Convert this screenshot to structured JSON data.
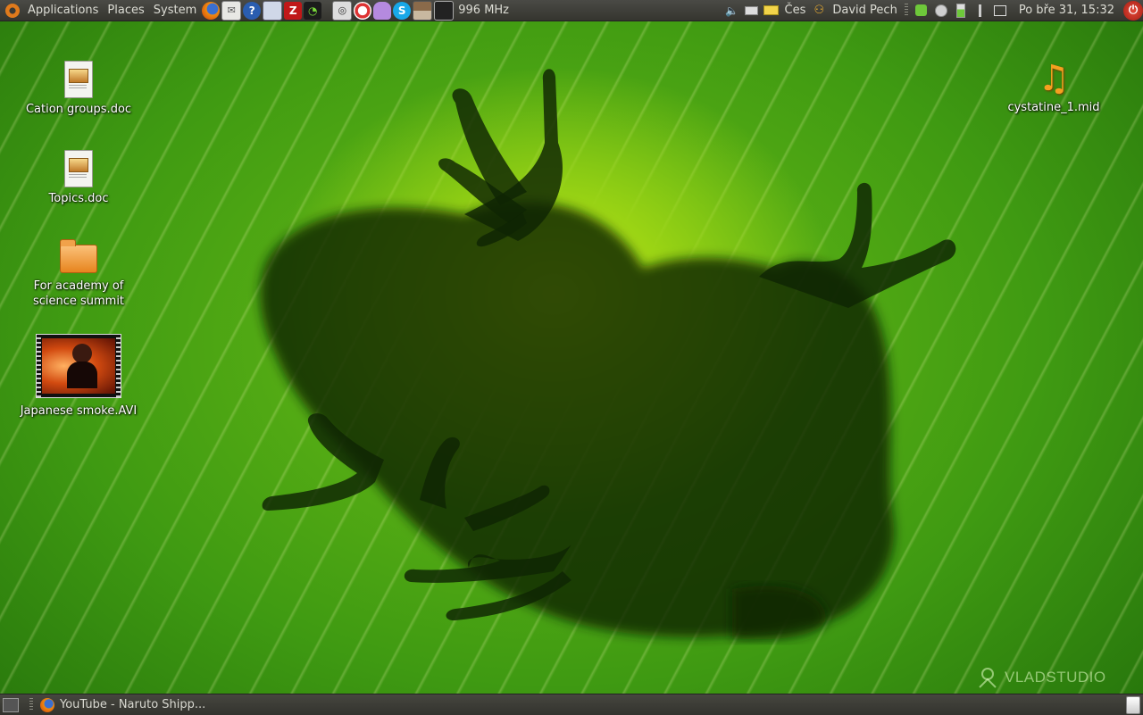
{
  "top_panel": {
    "menus": [
      "Applications",
      "Places",
      "System"
    ],
    "launchers": [
      {
        "icon": "firefox-icon"
      },
      {
        "icon": "mail-icon"
      },
      {
        "icon": "help-icon"
      },
      {
        "icon": "network-icon"
      },
      {
        "icon": "filezilla-icon",
        "glyph": "Z"
      },
      {
        "icon": "swirl-icon"
      },
      {
        "icon": "media-player-icon"
      },
      {
        "icon": "lifebuoy-icon"
      },
      {
        "icon": "pidgin-icon"
      },
      {
        "icon": "skype-icon",
        "glyph": "S"
      },
      {
        "icon": "brown-square-icon"
      },
      {
        "icon": "cpu-monitor-icon"
      }
    ],
    "cpu_freq": "996 MHz",
    "keyboard_layout": "Čes",
    "user_name": "David Pech",
    "clock": "Po bře 31, 15:32"
  },
  "desktop": {
    "icons_left": [
      {
        "label": "Cation groups.doc",
        "type": "doc"
      },
      {
        "label": "Topics.doc",
        "type": "doc"
      },
      {
        "label": "For academy of science summit",
        "type": "folder"
      },
      {
        "label": "Japanese smoke.AVI",
        "type": "video"
      }
    ],
    "icons_right": [
      {
        "label": "cystatine_1.mid",
        "type": "music"
      }
    ],
    "watermark": "VLADSTUDIO"
  },
  "bottom_panel": {
    "tasks": [
      {
        "label": "YouTube - Naruto Shipp...",
        "icon": "firefox-icon"
      }
    ]
  },
  "colors": {
    "panel_bg": "#3b3b36",
    "wallpaper_green": "#3f9a12",
    "wallpaper_highlight": "#c8f21a",
    "folder_orange": "#e7841e",
    "shutdown_red": "#d33a2a"
  }
}
